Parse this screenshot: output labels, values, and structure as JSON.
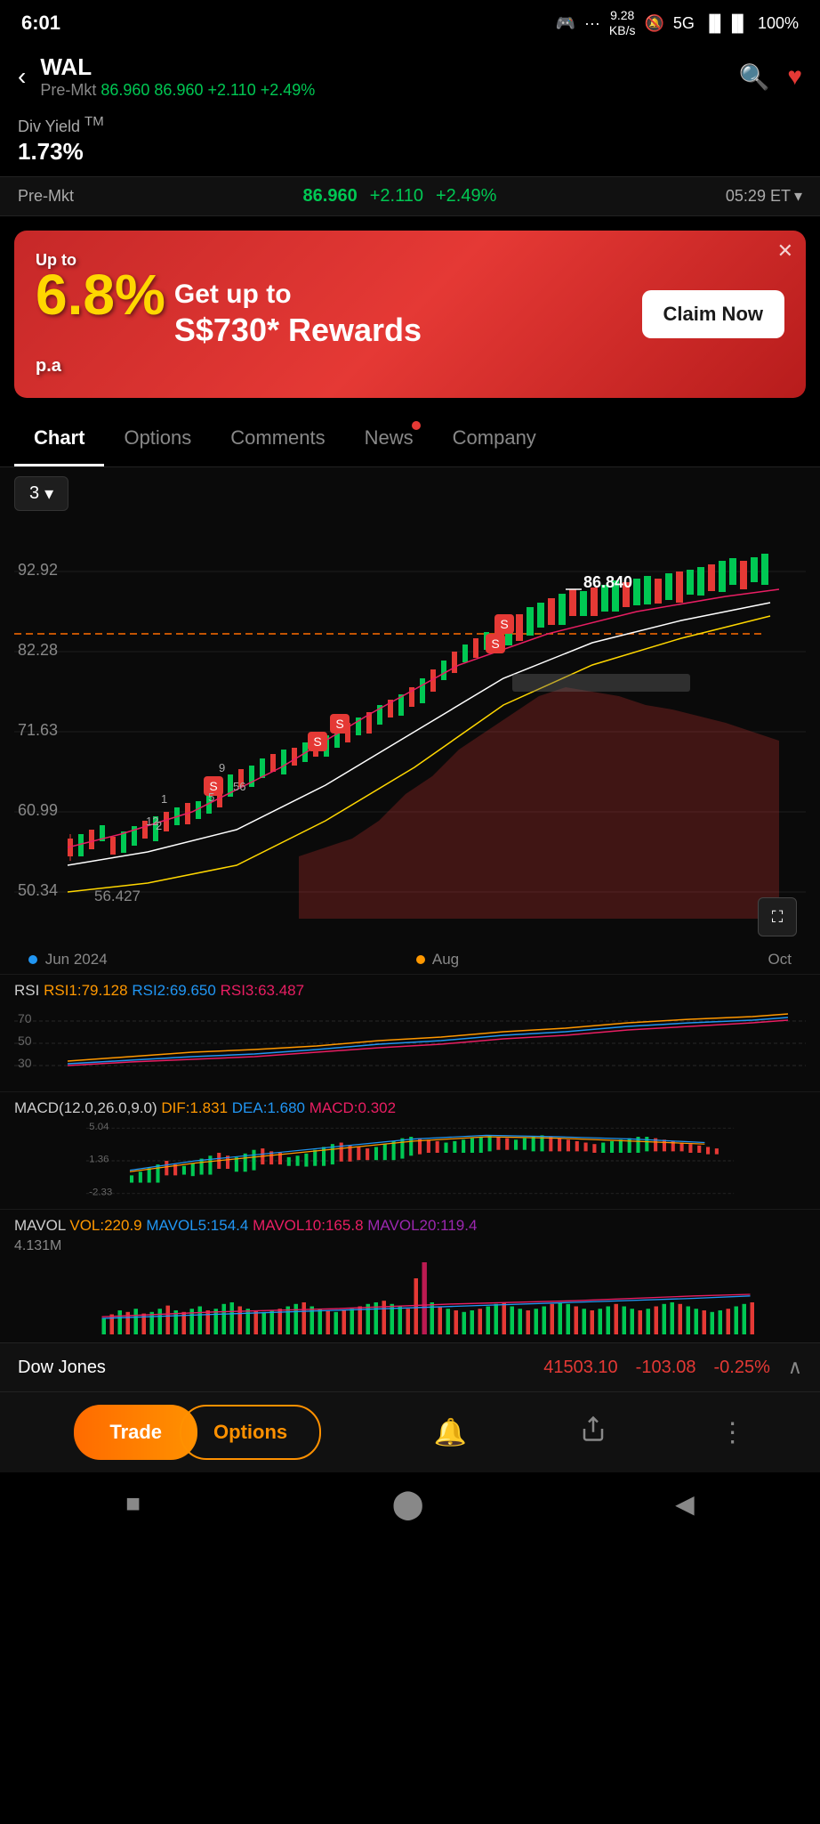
{
  "status": {
    "time": "6:01",
    "data_speed": "9.28\nKB/s",
    "signal": "5G",
    "battery": "100%"
  },
  "header": {
    "ticker": "WAL",
    "premkt_label": "Pre-Mkt",
    "price": "86.960",
    "change": "+2.110",
    "change_pct": "+2.49%",
    "back_label": "‹",
    "search_icon": "🔍",
    "heart_icon": "♥"
  },
  "div_yield": {
    "label": "Div Yield",
    "superscript": "TM",
    "value": "1.73%"
  },
  "premkt_bar": {
    "label": "Pre-Mkt",
    "price": "86.960",
    "change": "+2.110",
    "change_pct": "+2.49%",
    "time": "05:29 ET",
    "chevron": "▾"
  },
  "ad": {
    "up_to": "Up to",
    "percent": "6.8%",
    "pa": "p.a",
    "title": "Get up to",
    "subtitle": "S$730* Rewards",
    "cta": "Claim Now",
    "close": "✕"
  },
  "tabs": [
    {
      "label": "Chart",
      "active": true,
      "has_dot": false
    },
    {
      "label": "Options",
      "active": false,
      "has_dot": false
    },
    {
      "label": "Comments",
      "active": false,
      "has_dot": false
    },
    {
      "label": "News",
      "active": false,
      "has_dot": true
    },
    {
      "label": "Company",
      "active": false,
      "has_dot": false
    }
  ],
  "chart": {
    "period": "3",
    "period_chevron": "▾",
    "y_labels": [
      "92.92",
      "82.28",
      "71.63",
      "60.99",
      "50.34"
    ],
    "price_label": "86.840",
    "time_labels": [
      "Jun 2024",
      "Aug",
      "Oct"
    ],
    "fullscreen_icon": "⛶"
  },
  "rsi": {
    "label": "RSI",
    "v1_label": "RSI1:79.128",
    "v2_label": "RSI2:69.650",
    "v3_label": "RSI3:63.487",
    "y_labels": [
      "70",
      "50",
      "30"
    ]
  },
  "macd": {
    "label": "MACD(12.0,26.0,9.0)",
    "dif_label": "DIF:1.831",
    "dea_label": "DEA:1.680",
    "macd_label": "MACD:0.302",
    "y_labels": [
      "5.04",
      "1.36",
      "-2.33"
    ]
  },
  "mavol": {
    "label": "MAVOL",
    "vol_label": "VOL:220.9",
    "mav5_label": "MAVOL5:154.4",
    "mav10_label": "MAVOL10:165.8",
    "mav20_label": "MAVOL20:119.4",
    "y_label": "4.131M"
  },
  "dow_jones": {
    "name": "Dow Jones",
    "price": "41503.10",
    "change": "-103.08",
    "change_pct": "-0.25%",
    "chevron": "∧"
  },
  "bottom_bar": {
    "trade_label": "Trade",
    "options_label": "Options",
    "bell_icon": "🔔",
    "share_icon": "⬆",
    "more_icon": "⋮"
  },
  "nav_bar": {
    "square_icon": "■",
    "circle_icon": "⬤",
    "back_icon": "◀"
  }
}
